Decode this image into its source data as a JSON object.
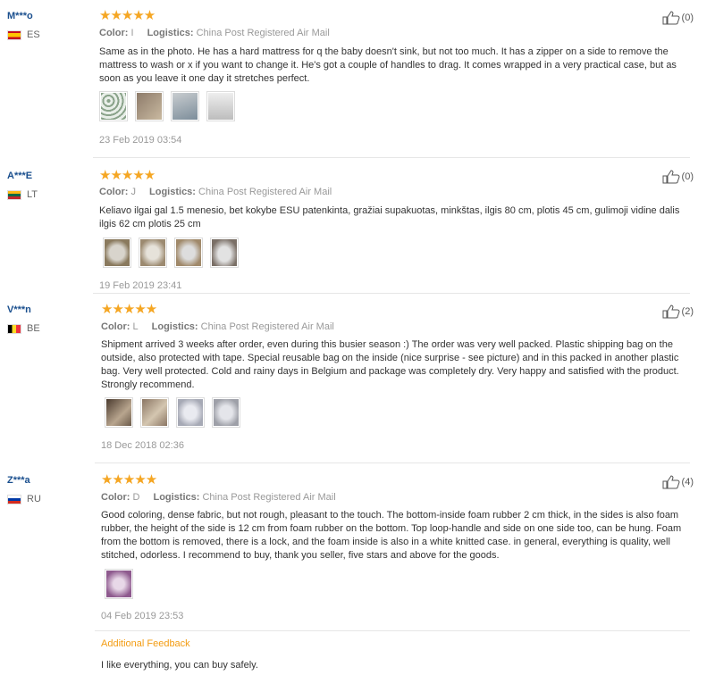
{
  "reviews": [
    {
      "user": "M***o",
      "country": "ES",
      "flag_colors": [
        "#c60b1e",
        "#ffc400",
        "#c60b1e"
      ],
      "stars": "★★★★★",
      "color_label": "Color:",
      "color_value": "I",
      "logistics_label": "Logistics:",
      "logistics_value": "China Post Registered Air Mail",
      "text": "Same as in the photo. He has a hard mattress for q the baby doesn't sink, but not too much. It has a zipper on a side to remove the mattress to wash or x if you want to change it. He's got a couple of handles to drag. It comes wrapped in a very practical case, but as soon as you leave it one day it stretches perfect.",
      "thumb_colors": [
        "#8aa38a",
        "#8d7b6a",
        "#c9cdd0",
        "#d8d8d8"
      ],
      "date": "23 Feb 2019 03:54",
      "likes": "(0)"
    },
    {
      "user": "A***E",
      "country": "LT",
      "flag_colors": [
        "#fdb913",
        "#006a44",
        "#c1272d"
      ],
      "stars": "★★★★★",
      "color_label": "Color:",
      "color_value": "J",
      "logistics_label": "Logistics:",
      "logistics_value": "China Post Registered Air Mail",
      "text": "Keliavo ilgai gal 1.5 menesio, bet kokybe ESU patenkinta, gražiai supakuotas, minkštas, ilgis 80 cm, plotis 45 cm, gulimoji vidine dalis ilgis 62 cm plotis 25 cm",
      "thumb_colors": [
        "#8a7a5e",
        "#9c8a70",
        "#a0896a",
        "#7a6f66"
      ],
      "date": "19 Feb 2019 23:41",
      "likes": "(0)"
    },
    {
      "user": "V***n",
      "country": "BE",
      "flag_colors": [
        "#000000",
        "#fdda24",
        "#ef3340"
      ],
      "stars": "★★★★★",
      "color_label": "Color:",
      "color_value": "L",
      "logistics_label": "Logistics:",
      "logistics_value": "China Post Registered Air Mail",
      "text": "Shipment arrived 3 weeks after order, even during this busier season :) The order was very well packed. Plastic shipping bag on the outside, also protected with tape. Special reusable bag on the inside (nice surprise - see picture) and in this packed in another plastic bag. Very well protected. Cold and rainy days in Belgium and package was completely dry. Very happy and satisfied with the product. Strongly recommend.",
      "thumb_colors": [
        "#6b5a4a",
        "#8a7563",
        "#a6a9b5",
        "#9ea0a8"
      ],
      "date": "18 Dec 2018 02:36",
      "likes": "(2)"
    },
    {
      "user": "Z***a",
      "country": "RU",
      "flag_colors": [
        "#ffffff",
        "#0039a6",
        "#d52b1e"
      ],
      "stars": "★★★★★",
      "color_label": "Color:",
      "color_value": "D",
      "logistics_label": "Logistics:",
      "logistics_value": "China Post Registered Air Mail",
      "text": "Good coloring, dense fabric, but not rough, pleasant to the touch. The bottom-inside foam rubber 2 cm thick, in the sides is also foam rubber, the height of the side is 12 cm from foam rubber on the bottom. Top loop-handle and side on one side too, can be hung. Foam from the bottom is removed, there is a lock, and the foam inside is also in a white knitted case. in general, everything is quality, well stitched, odorless. I recommend to buy, thank you seller, five stars and above for the goods.",
      "thumb_colors": [
        "#8e5a8e"
      ],
      "date": "04 Feb 2019 23:53",
      "likes": "(4)",
      "additional_title": "Additional Feedback",
      "additional_text": "I like everything, you can buy safely."
    }
  ]
}
